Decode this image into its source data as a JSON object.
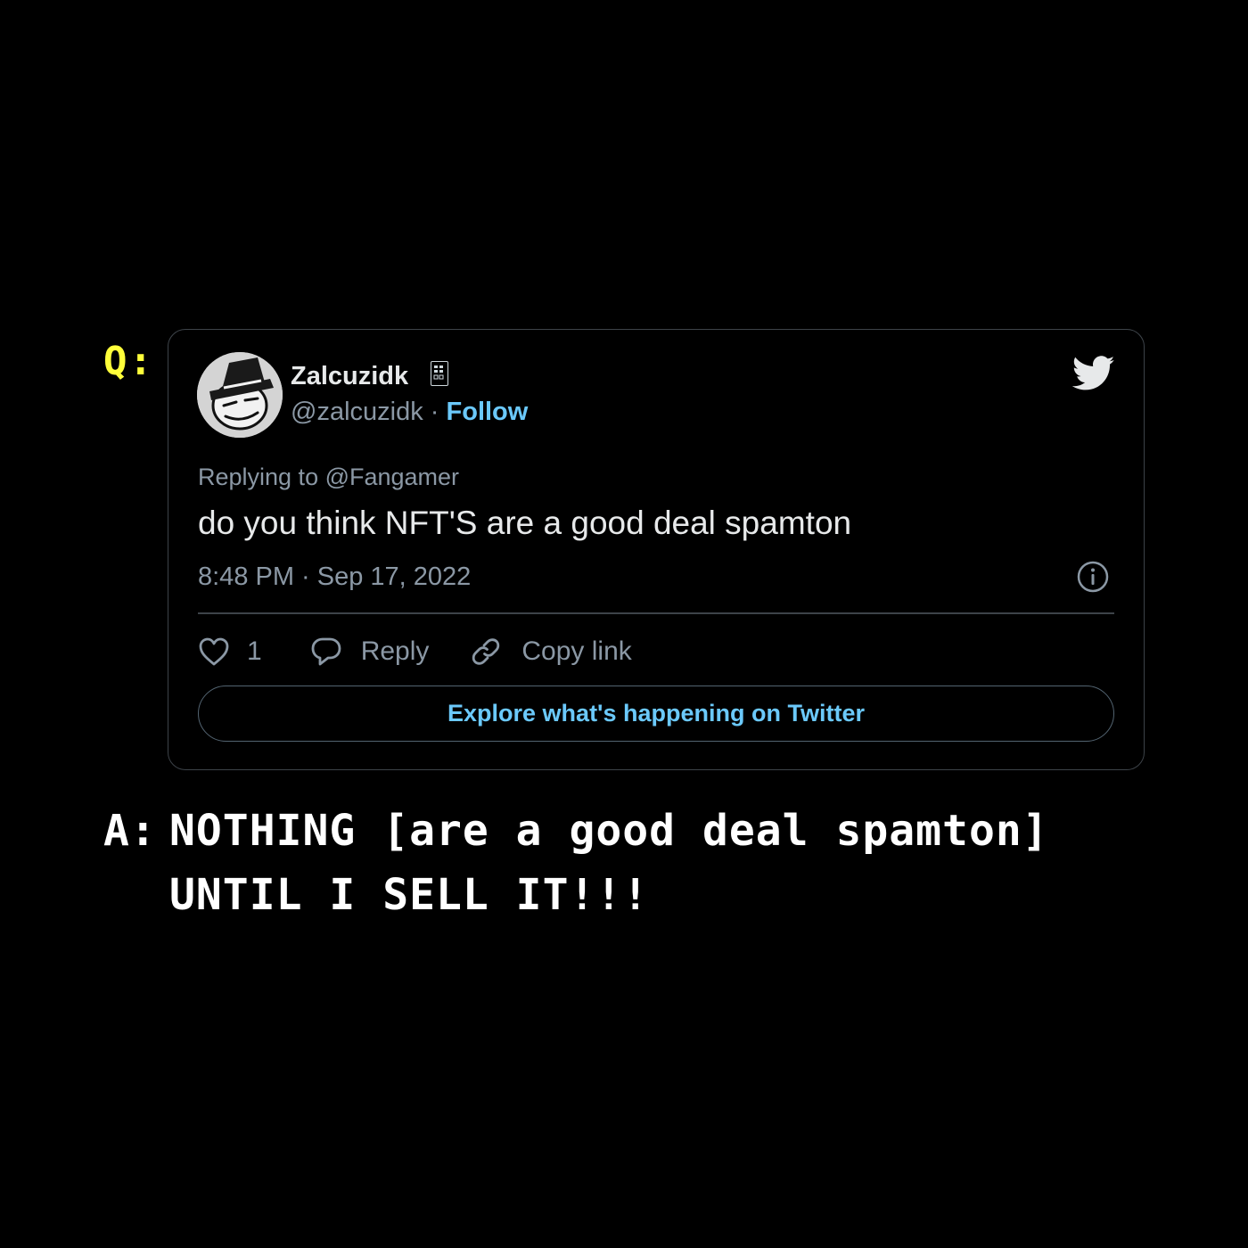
{
  "question_label": "Q:",
  "tweet": {
    "display_name": "Zalcuzidk",
    "handle": "@zalcuzidk",
    "separator": "·",
    "follow_label": "Follow",
    "reply_context": "Replying to @Fangamer",
    "text": "do you think NFT'S are a good deal spamton",
    "timestamp": "8:48 PM · Sep 17, 2022",
    "actions": {
      "like_count": "1",
      "reply_label": "Reply",
      "copy_label": "Copy link"
    },
    "explore_label": "Explore what's happening on Twitter",
    "link_color": "#6bc9fb"
  },
  "answer": {
    "label": "A:",
    "line1": "NOTHING [are a good deal spamton]",
    "line2": "UNTIL I SELL IT!!!"
  },
  "colors": {
    "background": "#000000",
    "question_label": "#ffff3a",
    "answer_text": "#ffffff"
  }
}
